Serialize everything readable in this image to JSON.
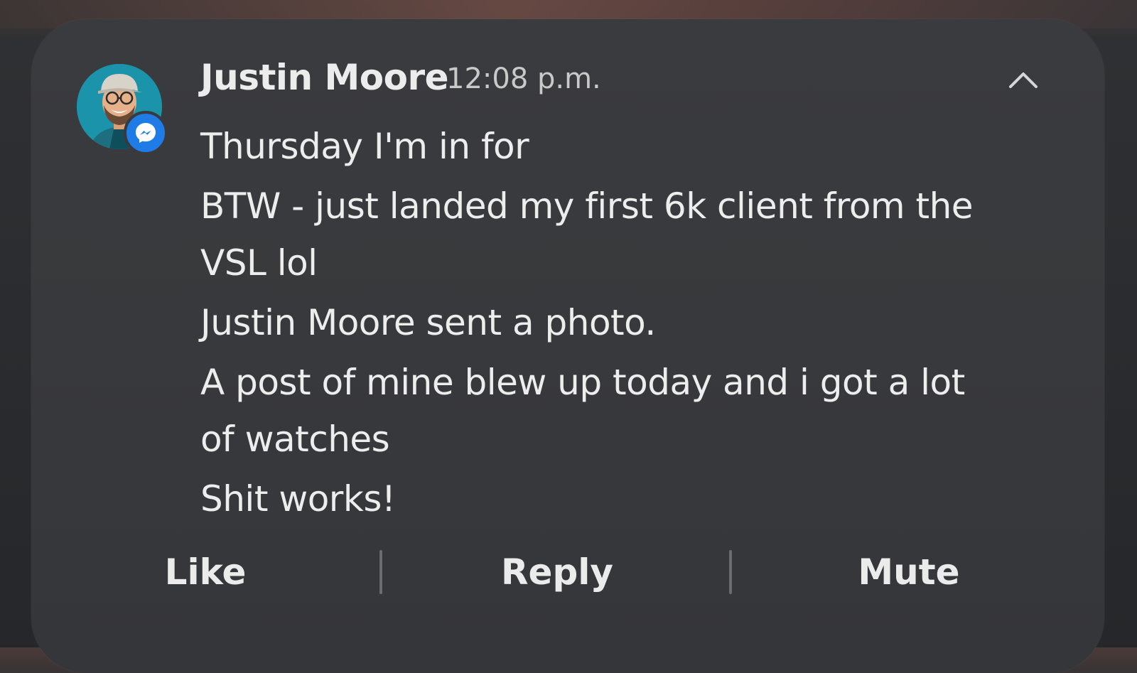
{
  "notification": {
    "sender": "Justin Moore",
    "time": "12:08 p.m.",
    "app_icon": "messenger-icon",
    "messages": [
      "Thursday I'm in for",
      "BTW - just landed my first 6k client from the VSL lol",
      "Justin Moore sent a photo.",
      "A post of mine blew up today and i got a lot of watches",
      "Shit works!"
    ],
    "actions": {
      "like": "Like",
      "reply": "Reply",
      "mute": "Mute"
    }
  },
  "colors": {
    "card_background": "#38393c",
    "text_primary": "#ececec",
    "text_secondary": "#c9c9c9",
    "messenger_blue": "#1f7be6",
    "avatar_bg": "#1a8ea6"
  }
}
